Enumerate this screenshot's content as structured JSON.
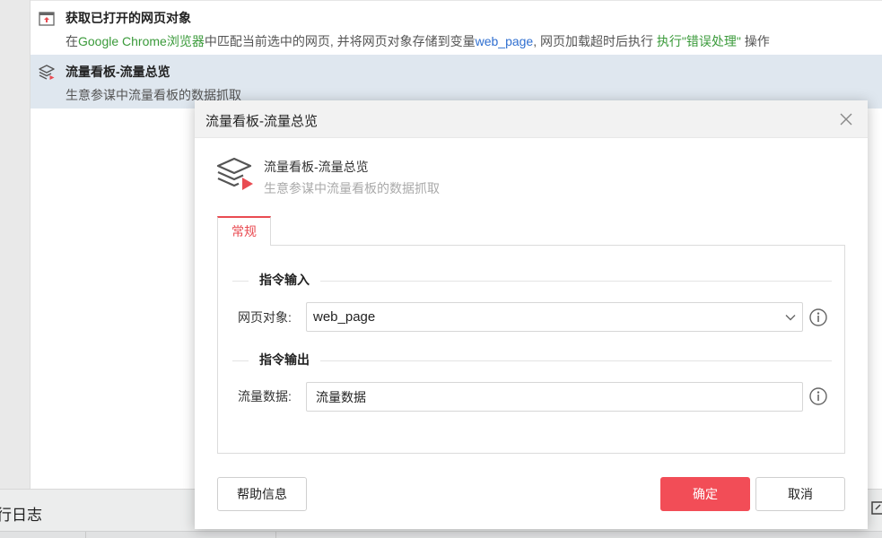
{
  "flow": {
    "items": [
      {
        "title": "获取已打开的网页对象",
        "desc_parts": [
          "在",
          "Google Chrome浏览器",
          "中匹配当前选中的网页, 并将网页对象存储到变量",
          "web_page",
          ", 网页加载超时后执行 ",
          "执行\"错误处理\"",
          " 操作"
        ]
      },
      {
        "title": "流量看板-流量总览",
        "desc": "生意参谋中流量看板的数据抓取"
      }
    ]
  },
  "bottom": {
    "log_title": "行日志"
  },
  "dialog": {
    "title": "流量看板-流量总览",
    "command_name": "流量看板-流量总览",
    "command_desc": "生意参谋中流量看板的数据抓取",
    "tab_label": "常规",
    "input_section_label": "指令输入",
    "output_section_label": "指令输出",
    "fields": {
      "web_object_label": "网页对象:",
      "web_object_value": "web_page",
      "traffic_data_label": "流量数据:",
      "traffic_data_value": "流量数据"
    },
    "buttons": {
      "help": "帮助信息",
      "ok": "确定",
      "cancel": "取消"
    }
  },
  "colors": {
    "accent_red": "#f24d57",
    "selected_row": "#dfe7ef",
    "token_green": "#3a9a3a",
    "token_blue": "#2f6fd0"
  },
  "icons": [
    "browser-tab-icon",
    "layers-play-icon",
    "close-icon",
    "chevron-down-icon",
    "info-icon",
    "export-icon"
  ]
}
